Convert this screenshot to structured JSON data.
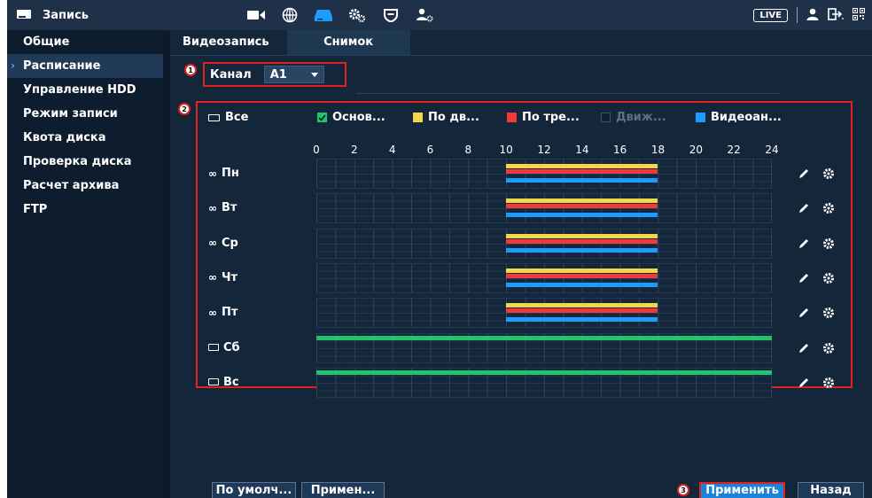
{
  "app": {
    "title": "Запись",
    "live_label": "LIVE",
    "top_icons": [
      "camera-icon",
      "network-icon",
      "storage-icon",
      "settings-icon",
      "shield-icon",
      "account-icon"
    ]
  },
  "sidebar": {
    "items": [
      {
        "label": "Общие",
        "active": false
      },
      {
        "label": "Расписание",
        "active": true
      },
      {
        "label": "Управление HDD",
        "active": false
      },
      {
        "label": "Режим записи",
        "active": false
      },
      {
        "label": "Квота диска",
        "active": false
      },
      {
        "label": "Проверка диска",
        "active": false
      },
      {
        "label": "Расчет архива",
        "active": false
      },
      {
        "label": "FTP",
        "active": false
      }
    ]
  },
  "tabs": [
    {
      "label": "Видеозапись",
      "selected": true
    },
    {
      "label": "Снимок",
      "selected": false
    }
  ],
  "channel": {
    "label": "Канал",
    "value": "A1"
  },
  "badges": [
    "1",
    "2",
    "3"
  ],
  "legend": [
    {
      "label": "Все",
      "kind": "hollow",
      "color": "#ffffff"
    },
    {
      "label": "Основ...",
      "kind": "check",
      "color": "#22c36b"
    },
    {
      "label": "По дв...",
      "kind": "fill",
      "color": "#f5d54a"
    },
    {
      "label": "По тре...",
      "kind": "fill",
      "color": "#f03a3a"
    },
    {
      "label": "Движ...",
      "kind": "disabled",
      "color": "#3f546c"
    },
    {
      "label": "Видеоан...",
      "kind": "fill",
      "color": "#1e9bff"
    }
  ],
  "hour_ticks": [
    "0",
    "2",
    "4",
    "6",
    "8",
    "10",
    "12",
    "14",
    "16",
    "18",
    "20",
    "22",
    "24"
  ],
  "colors": {
    "general": "#22c36b",
    "motion": "#f5d54a",
    "alarm": "#f03a3a",
    "analytics": "#1e9bff",
    "highlight": "#e32020"
  },
  "days": [
    {
      "label": "Пн",
      "linked": true,
      "segments": [
        {
          "type": "motion",
          "start": 10,
          "end": 18
        },
        {
          "type": "alarm",
          "start": 10,
          "end": 18
        },
        {
          "type": "analytics",
          "start": 10,
          "end": 18
        }
      ]
    },
    {
      "label": "Вт",
      "linked": true,
      "segments": [
        {
          "type": "motion",
          "start": 10,
          "end": 18
        },
        {
          "type": "alarm",
          "start": 10,
          "end": 18
        },
        {
          "type": "analytics",
          "start": 10,
          "end": 18
        }
      ]
    },
    {
      "label": "Ср",
      "linked": true,
      "segments": [
        {
          "type": "motion",
          "start": 10,
          "end": 18
        },
        {
          "type": "alarm",
          "start": 10,
          "end": 18
        },
        {
          "type": "analytics",
          "start": 10,
          "end": 18
        }
      ]
    },
    {
      "label": "Чт",
      "linked": true,
      "segments": [
        {
          "type": "motion",
          "start": 10,
          "end": 18
        },
        {
          "type": "alarm",
          "start": 10,
          "end": 18
        },
        {
          "type": "analytics",
          "start": 10,
          "end": 18
        }
      ]
    },
    {
      "label": "Пт",
      "linked": true,
      "segments": [
        {
          "type": "motion",
          "start": 10,
          "end": 18
        },
        {
          "type": "alarm",
          "start": 10,
          "end": 18
        },
        {
          "type": "analytics",
          "start": 10,
          "end": 18
        }
      ]
    },
    {
      "label": "Сб",
      "linked": false,
      "segments": [
        {
          "type": "general",
          "start": 0,
          "end": 24
        }
      ]
    },
    {
      "label": "Вс",
      "linked": false,
      "segments": [
        {
          "type": "general",
          "start": 0,
          "end": 24
        }
      ]
    }
  ],
  "buttons": {
    "default": "По умолч...",
    "copy": "Примен...",
    "apply": "Применить",
    "back": "Назад"
  }
}
